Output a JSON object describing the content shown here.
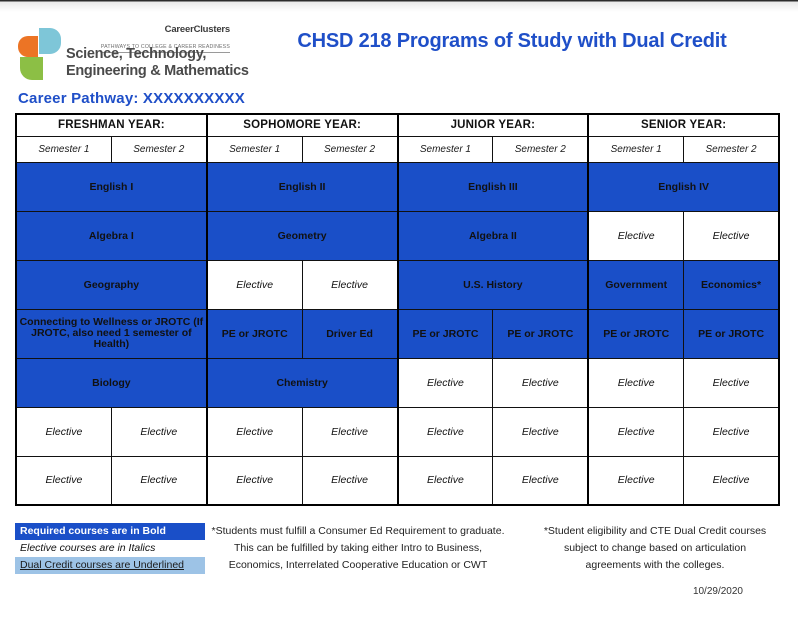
{
  "header": {
    "logo": {
      "brand_name": "CareerClusters",
      "brand_trademark": "®",
      "brand_tagline": "PATHWAYS TO COLLEGE & CAREER READINESS",
      "cluster_name": "Science, Technology, Engineering & Mathematics",
      "colors": {
        "orange": "#ec7425",
        "teal": "#7ec6d8",
        "green": "#8cbf45"
      }
    },
    "title": "CHSD 218 Programs of Study with Dual Credit",
    "title_color": "#1f4fc8",
    "pathway_label": "Career Pathway: XXXXXXXXXX"
  },
  "table": {
    "year_headers": [
      "FRESHMAN YEAR:",
      "SOPHOMORE YEAR:",
      "JUNIOR YEAR:",
      "SENIOR YEAR:"
    ],
    "semester_headers": [
      "Semester 1",
      "Semester 2",
      "Semester 1",
      "Semester 2",
      "Semester 1",
      "Semester 2",
      "Semester 1",
      "Semester 2"
    ],
    "required_color": "#1a4fc8",
    "rows": [
      {
        "name": "english-row",
        "cells": [
          {
            "text": "English I",
            "type": "required",
            "span": 2
          },
          {
            "text": "English II",
            "type": "required",
            "span": 2
          },
          {
            "text": "English III",
            "type": "required",
            "span": 2
          },
          {
            "text": "English IV",
            "type": "required",
            "span": 2
          }
        ]
      },
      {
        "name": "math-row",
        "cells": [
          {
            "text": "Algebra I",
            "type": "required",
            "span": 2
          },
          {
            "text": "Geometry",
            "type": "required",
            "span": 2
          },
          {
            "text": "Algebra II",
            "type": "required",
            "span": 2
          },
          {
            "text": "Elective",
            "type": "elective",
            "span": 1
          },
          {
            "text": "Elective",
            "type": "elective",
            "span": 1
          }
        ]
      },
      {
        "name": "social-studies-row",
        "cells": [
          {
            "text": "Geography",
            "type": "required",
            "span": 2
          },
          {
            "text": "Elective",
            "type": "elective",
            "span": 1
          },
          {
            "text": "Elective",
            "type": "elective",
            "span": 1
          },
          {
            "text": "U.S. History",
            "type": "required",
            "span": 2
          },
          {
            "text": "Government",
            "type": "required",
            "span": 1
          },
          {
            "text": "Economics*",
            "type": "required",
            "span": 1
          }
        ]
      },
      {
        "name": "pe-jrotc-row",
        "cells": [
          {
            "text": "Connecting to Wellness or JROTC (If JROTC, also need 1 semester of Health)",
            "type": "required",
            "span": 2,
            "small": true
          },
          {
            "text": "PE or JROTC",
            "type": "required",
            "span": 1
          },
          {
            "text": "Driver Ed",
            "type": "required",
            "span": 1
          },
          {
            "text": "PE or JROTC",
            "type": "required",
            "span": 1
          },
          {
            "text": "PE or JROTC",
            "type": "required",
            "span": 1
          },
          {
            "text": "PE or JROTC",
            "type": "required",
            "span": 1
          },
          {
            "text": "PE or JROTC",
            "type": "required",
            "span": 1
          }
        ]
      },
      {
        "name": "science-row",
        "cells": [
          {
            "text": "Biology",
            "type": "required",
            "span": 2
          },
          {
            "text": "Chemistry",
            "type": "required",
            "span": 2
          },
          {
            "text": "Elective",
            "type": "elective",
            "span": 1
          },
          {
            "text": "Elective",
            "type": "elective",
            "span": 1
          },
          {
            "text": "Elective",
            "type": "elective",
            "span": 1
          },
          {
            "text": "Elective",
            "type": "elective",
            "span": 1
          }
        ]
      },
      {
        "name": "elective-row-1",
        "cells": [
          {
            "text": "Elective",
            "type": "elective",
            "span": 1
          },
          {
            "text": "Elective",
            "type": "elective",
            "span": 1
          },
          {
            "text": "Elective",
            "type": "elective",
            "span": 1
          },
          {
            "text": "Elective",
            "type": "elective",
            "span": 1
          },
          {
            "text": "Elective",
            "type": "elective",
            "span": 1
          },
          {
            "text": "Elective",
            "type": "elective",
            "span": 1
          },
          {
            "text": "Elective",
            "type": "elective",
            "span": 1
          },
          {
            "text": "Elective",
            "type": "elective",
            "span": 1
          }
        ]
      },
      {
        "name": "elective-row-2",
        "cells": [
          {
            "text": "Elective",
            "type": "elective",
            "span": 1
          },
          {
            "text": "Elective",
            "type": "elective",
            "span": 1
          },
          {
            "text": "Elective",
            "type": "elective",
            "span": 1
          },
          {
            "text": "Elective",
            "type": "elective",
            "span": 1
          },
          {
            "text": "Elective",
            "type": "elective",
            "span": 1
          },
          {
            "text": "Elective",
            "type": "elective",
            "span": 1
          },
          {
            "text": "Elective",
            "type": "elective",
            "span": 1
          },
          {
            "text": "Elective",
            "type": "elective",
            "span": 1
          }
        ]
      }
    ]
  },
  "legend": {
    "required": "Required courses are in Bold",
    "elective": "Elective courses are in Italics",
    "dual_credit": "Dual Credit courses are Underlined",
    "required_bg": "#1a4fc8",
    "dual_credit_bg": "#9dc3e6"
  },
  "notes": {
    "left": [
      "*Students must fulfill a Consumer Ed Requirement to graduate.",
      "This can be fulfilled by taking either Intro to Business,",
      "Economics, Interrelated Cooperative Education or CWT"
    ],
    "right": [
      "*Student eligibility and CTE Dual Credit courses",
      "subject to change based on articulation",
      "agreements with the colleges."
    ]
  },
  "date": "10/29/2020"
}
